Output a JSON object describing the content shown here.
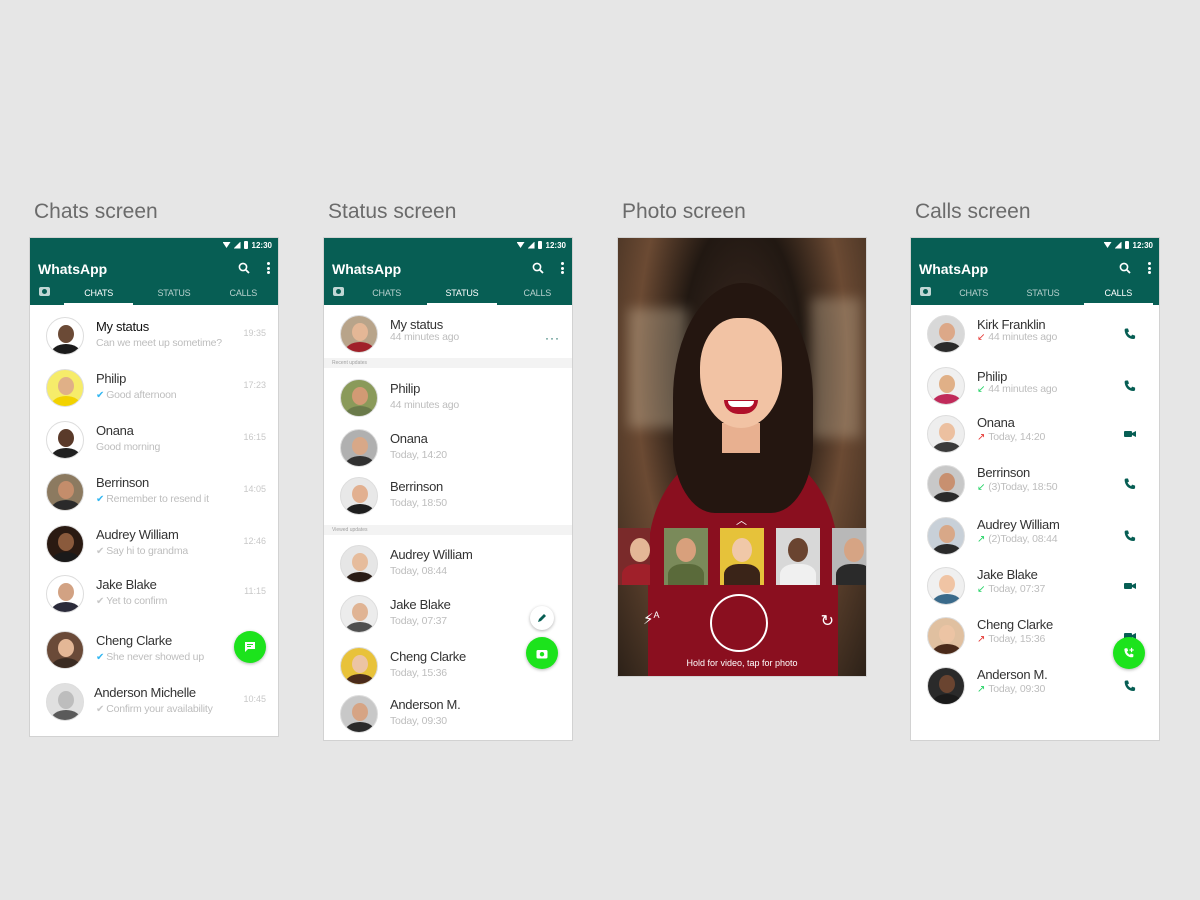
{
  "screens": {
    "chats": {
      "title": "Chats screen"
    },
    "status": {
      "title": "Status screen"
    },
    "photo": {
      "title": "Photo screen"
    },
    "calls": {
      "title": "Calls screen"
    }
  },
  "statusbar": {
    "time": "12:30"
  },
  "app": {
    "title": "WhatsApp"
  },
  "tabs": {
    "chats": "CHATS",
    "status": "STATUS",
    "calls": "CALLS"
  },
  "chats": [
    {
      "name": "My status",
      "message": "Can we meet up sometime?",
      "time": "19:35",
      "tick": "none"
    },
    {
      "name": "Philip",
      "message": "Good afternoon",
      "time": "17:23",
      "tick": "blue"
    },
    {
      "name": "Onana",
      "message": "Good morning",
      "time": "16:15",
      "tick": "none"
    },
    {
      "name": "Berrinson",
      "message": "Remember to resend it",
      "time": "14:05",
      "tick": "blue"
    },
    {
      "name": "Audrey William",
      "message": "Say hi to grandma",
      "time": "12:46",
      "tick": "grey"
    },
    {
      "name": "Jake Blake",
      "message": "Yet to confirm",
      "time": "11:15",
      "tick": "grey"
    },
    {
      "name": "Cheng Clarke",
      "message": "She never showed up",
      "time": "",
      "tick": "blue"
    },
    {
      "name": "Anderson Michelle",
      "message": "Confirm your availability",
      "time": "10:45",
      "tick": "grey"
    }
  ],
  "status": {
    "my": {
      "name": "My status",
      "time": "44 minutes ago"
    },
    "recent_label": "Recent updates",
    "recent": [
      {
        "name": "Philip",
        "time": "44 minutes ago"
      },
      {
        "name": "Onana",
        "time": "Today, 14:20"
      },
      {
        "name": "Berrinson",
        "time": "Today, 18:50"
      }
    ],
    "viewed_label": "Viewed updates",
    "viewed": [
      {
        "name": "Audrey William",
        "time": "Today, 08:44"
      },
      {
        "name": "Jake Blake",
        "time": "Today, 07:37"
      },
      {
        "name": "Cheng Clarke",
        "time": "Today, 15:36"
      },
      {
        "name": "Anderson M.",
        "time": "Today, 09:30"
      }
    ]
  },
  "photo": {
    "hint": "Hold for video, tap for photo",
    "flash_label": "A"
  },
  "calls": [
    {
      "name": "Kirk Franklin",
      "detail": "44 minutes ago",
      "direction": "missed",
      "type": "voice"
    },
    {
      "name": "Philip",
      "detail": "44 minutes ago",
      "direction": "incoming",
      "type": "voice"
    },
    {
      "name": "Onana",
      "detail": "Today, 14:20",
      "direction": "missed-out",
      "type": "video"
    },
    {
      "name": "Berrinson",
      "detail": "(3)Today, 18:50",
      "direction": "incoming",
      "type": "voice"
    },
    {
      "name": "Audrey William",
      "detail": "(2)Today, 08:44",
      "direction": "outgoing",
      "type": "voice"
    },
    {
      "name": "Jake Blake",
      "detail": "Today, 07:37",
      "direction": "incoming",
      "type": "video"
    },
    {
      "name": "Cheng Clarke",
      "detail": "Today, 15:36",
      "direction": "missed-out",
      "type": "video"
    },
    {
      "name": "Anderson M.",
      "detail": "Today, 09:30",
      "direction": "outgoing",
      "type": "voice"
    }
  ],
  "colors": {
    "primary": "#075e54",
    "fab": "#1ce31c",
    "tick": "#34b7f1"
  },
  "icons": {
    "search": "search-icon",
    "more": "more-vert-icon",
    "camera": "camera-icon",
    "chat": "new-chat-icon",
    "pencil": "pencil-icon",
    "phone": "phone-icon",
    "video": "videocam-icon",
    "new_call": "new-call-icon",
    "flash": "flash-auto-icon",
    "rotate": "switch-camera-icon",
    "shutter": "shutter-button"
  }
}
